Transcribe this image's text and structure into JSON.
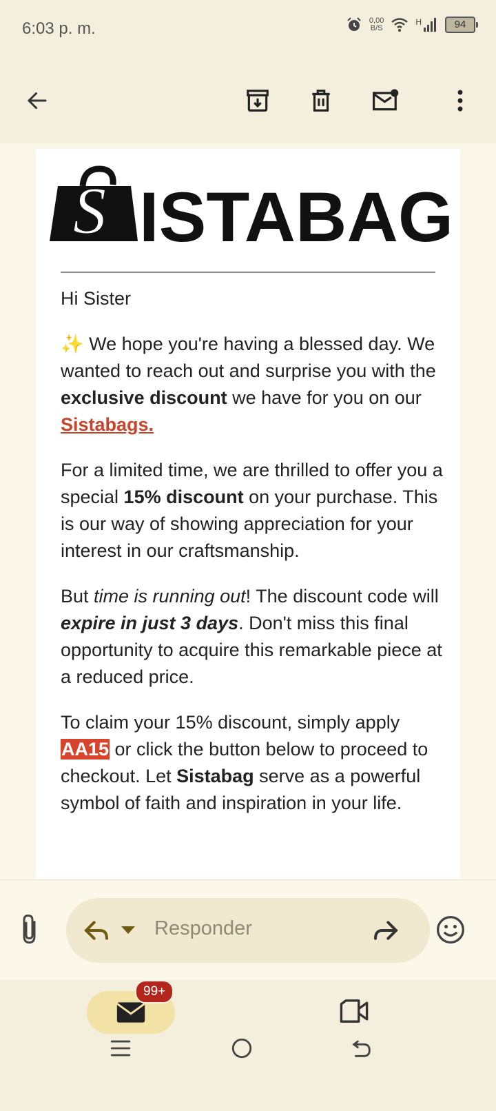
{
  "status_bar": {
    "time": "6:03 p. m.",
    "net_speed_value": "0,00",
    "net_speed_unit": "B/S",
    "network_type": "H",
    "battery_level": "94"
  },
  "toolbar": {
    "icons": [
      "back-arrow-icon",
      "archive-icon",
      "delete-icon",
      "mark-unread-icon",
      "more-vert-icon"
    ]
  },
  "email": {
    "logo_text": "ISTABAG",
    "logo_letter": "S",
    "greeting": "Hi Sister",
    "p1": {
      "emoji": "✨",
      "text_a": " We hope you're having a blessed day. We wanted to reach out and surprise you with the ",
      "bold": "exclusive discount",
      "text_b": " we have for you on our ",
      "link": "Sistabags."
    },
    "p2": {
      "text_a": "For a limited time, we are thrilled to offer you a special ",
      "bold": "15% discount",
      "text_b": " on your purchase. This is our way of showing appreciation for your interest in our craftsmanship."
    },
    "p3": {
      "text_a": "But ",
      "italic": "time is running out",
      "text_b": "! The discount code will ",
      "bold_italic": "expire in just 3 days",
      "text_c": ". Don't miss this final opportunity to acquire this remarkable piece at a reduced price."
    },
    "p4": {
      "text_a": "To claim your 15% discount, simply apply ",
      "code": "AA15",
      "text_b": " or click the button below to proceed to checkout. Let ",
      "bold": "Sistabag",
      "text_c": " serve as a powerful symbol of faith and inspiration in your life."
    }
  },
  "reply_bar": {
    "placeholder": "Responder"
  },
  "bottom_nav": {
    "mail_badge": "99+"
  },
  "colors": {
    "background": "#f4efdc",
    "link": "#c8452b",
    "code_highlight": "#d6442b",
    "badge": "#b3261e"
  }
}
